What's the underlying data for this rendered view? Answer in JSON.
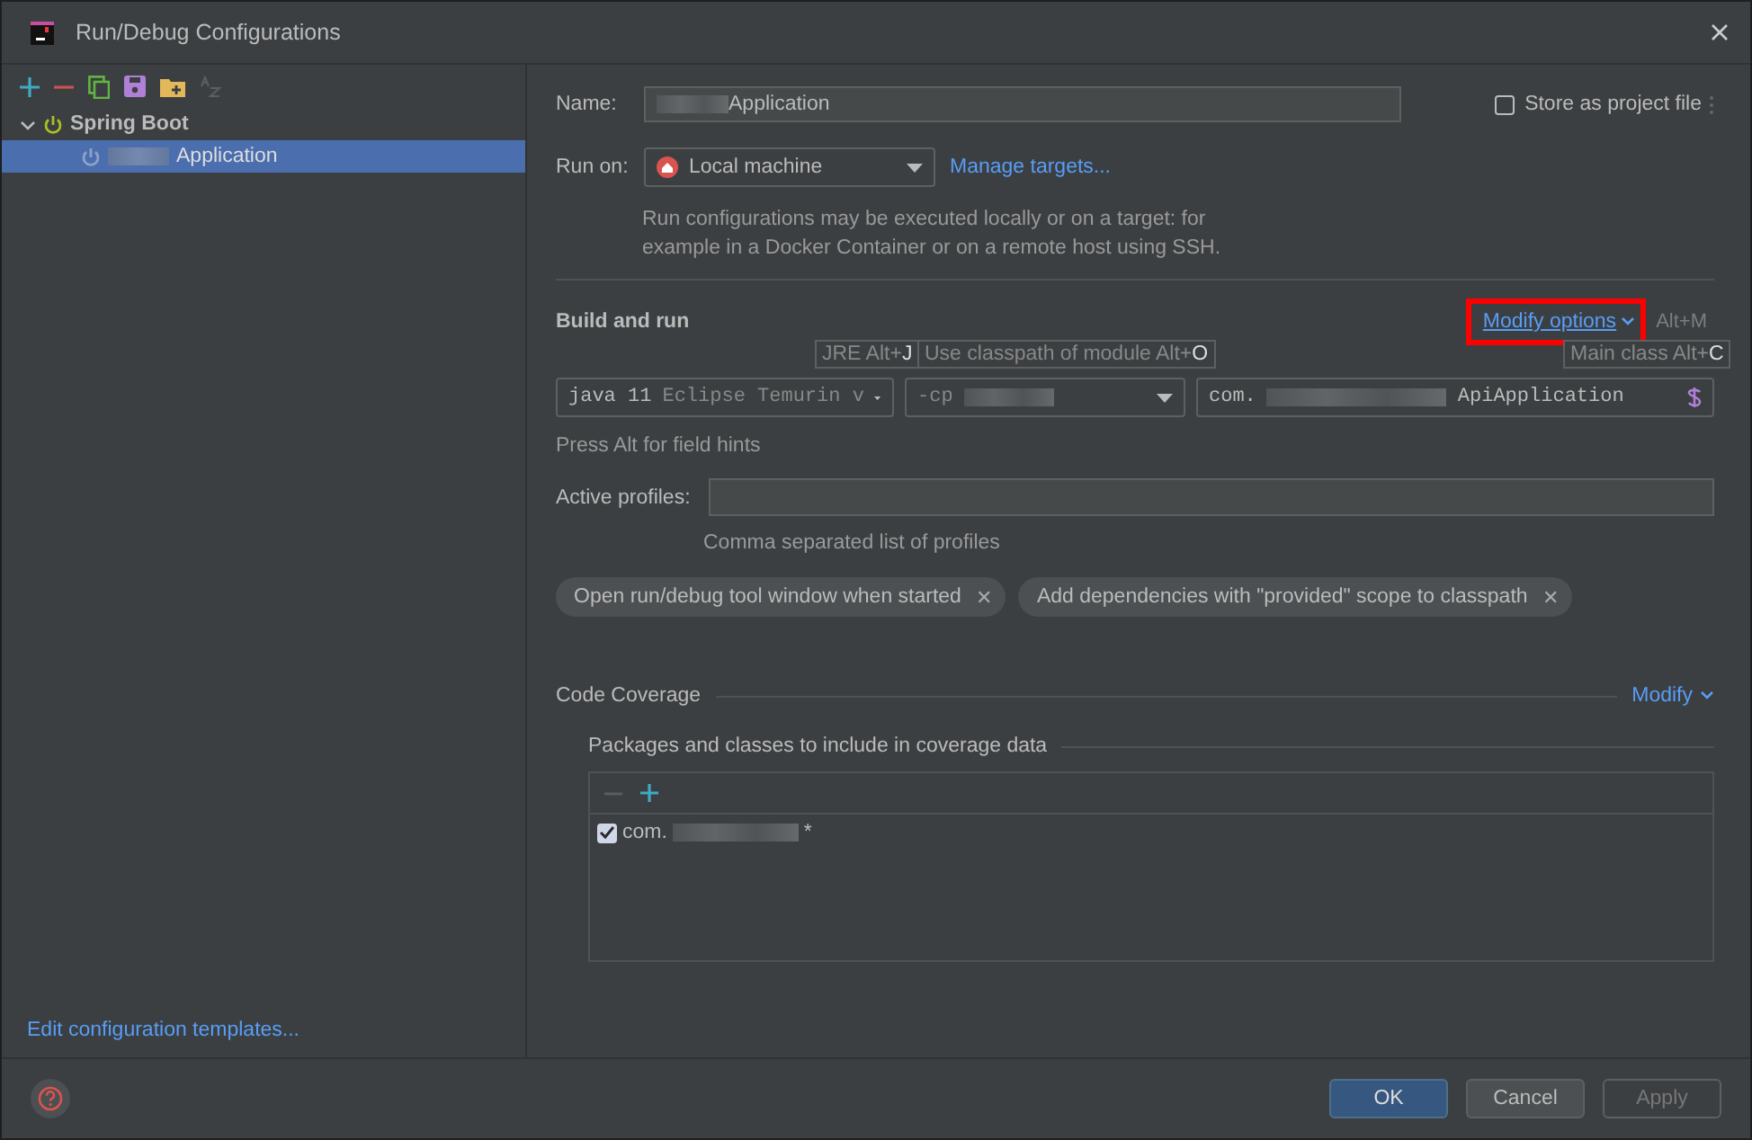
{
  "window": {
    "title": "Run/Debug Configurations"
  },
  "tree": [
    {
      "label": "Spring Boot",
      "expanded": true,
      "children": [
        {
          "label": "Application",
          "selected": true,
          "redacted": true
        }
      ]
    }
  ],
  "edit_templates_link": "Edit configuration templates...",
  "name": {
    "label": "Name:",
    "value": "Application",
    "redacted": true
  },
  "store_as_project_file": {
    "label": "Store as project file",
    "checked": false
  },
  "run_on": {
    "label": "Run on:",
    "value": "Local machine",
    "link": "Manage targets...",
    "help": "Run configurations may be executed locally or on a target: for example in a Docker Container or on a remote host using SSH."
  },
  "build_and_run": {
    "title": "Build and run",
    "modify_options": "Modify options",
    "modify_shortcut": "Alt+M",
    "hints": [
      {
        "text": "JRE Alt+**J**"
      },
      {
        "text": "Use classpath of module Alt+**O**"
      },
      {
        "text": "Main class Alt+**C**"
      }
    ],
    "jre": {
      "value": "java 11",
      "detail": "Eclipse Temurin v"
    },
    "classpath": {
      "value": "-cp"
    },
    "main_class": {
      "prefix": "com.",
      "suffix": "ApiApplication"
    },
    "field_hint": "Press Alt for field hints"
  },
  "active_profiles": {
    "label": "Active profiles:",
    "hint": "Comma separated list of profiles"
  },
  "options": [
    {
      "label": "Open run/debug tool window when started",
      "remove": "✕"
    },
    {
      "label": "Add dependencies with \"provided\" scope to classpath",
      "remove": "✕"
    }
  ],
  "code_coverage": {
    "title": "Code Coverage",
    "modify": "Modify",
    "subtitle": "Packages and classes to include in coverage data",
    "items": [
      {
        "prefix": "com.",
        "suffix": "*",
        "checked": true
      }
    ]
  },
  "buttons": [
    {
      "label": "OK",
      "kind": "primary",
      "disabled": false
    },
    {
      "label": "Cancel",
      "kind": "normal",
      "disabled": false
    },
    {
      "label": "Apply",
      "kind": "normal",
      "disabled": true
    }
  ]
}
